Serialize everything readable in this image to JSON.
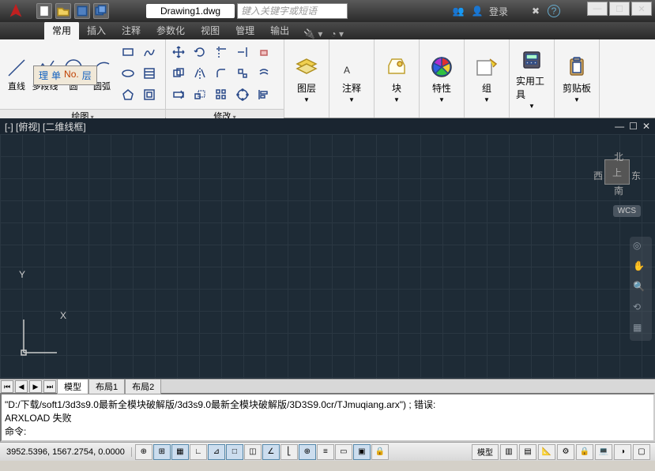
{
  "app": {
    "title": "Drawing1.dwg",
    "search_placeholder": "键入关键字或短语",
    "login": "登录"
  },
  "tabs": [
    "常用",
    "插入",
    "注释",
    "参数化",
    "视图",
    "管理",
    "输出"
  ],
  "ribbon": {
    "draw_panel": "绘图",
    "modify_panel": "修改",
    "layer": "图层",
    "annotation": "注释",
    "block": "块",
    "properties": "特性",
    "group": "组",
    "utilities": "实用工具",
    "clipboard": "剪贴板",
    "tools": {
      "line": "直线",
      "polyline": "多段线",
      "circle": "圆",
      "arc": "圆弧"
    }
  },
  "float_toolbar": [
    "理",
    "单",
    "No.",
    "层"
  ],
  "viewport": {
    "header": "[-] [俯视] [二维线框]",
    "wcs": "WCS",
    "compass": {
      "n": "北",
      "s": "南",
      "e": "东",
      "w": "西",
      "top": "上"
    }
  },
  "layout_tabs": {
    "model": "模型",
    "layout1": "布局1",
    "layout2": "布局2"
  },
  "command": {
    "line1": "\"D:/下载/soft1/3d3s9.0最新全模块破解版/3d3s9.0最新全模块破解版/3D3S9.0cr/TJmuqiang.arx\") ; 错误:",
    "line2": "ARXLOAD 失败",
    "prompt": "命令:"
  },
  "status": {
    "coords": "3952.5396, 1567.2754, 0.0000",
    "model": "模型"
  },
  "icons": {
    "new": "new",
    "open": "open",
    "save": "save",
    "saveall": "saveall"
  }
}
